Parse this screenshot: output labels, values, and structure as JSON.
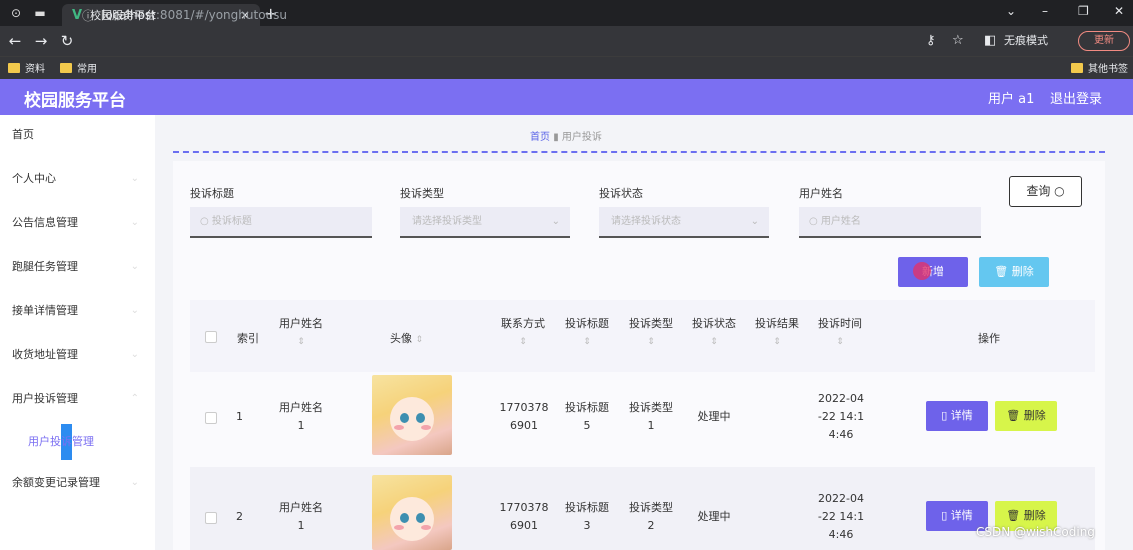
{
  "browser": {
    "tab_title": "校园服务平台",
    "tab_close": "×",
    "new_tab": "+",
    "url_host": "localhost",
    "url_path": ":8081/#/yonghutousu",
    "incognito_label": "无痕模式",
    "update_label": "更新",
    "bookmarks": [
      "资料",
      "常用"
    ],
    "other_bookmarks": "其他书签"
  },
  "header": {
    "brand": "校园服务平台",
    "user": "用户 a1",
    "logout": "退出登录"
  },
  "sidebar": {
    "items": [
      "首页",
      "个人中心",
      "公告信息管理",
      "跑腿任务管理",
      "接单详情管理",
      "收货地址管理",
      "用户投诉管理",
      "余额变更记录管理"
    ],
    "sub_item": "用户投诉管理"
  },
  "breadcrumb": {
    "home": "首页",
    "current": "用户投诉"
  },
  "filters": {
    "title_label": "投诉标题",
    "title_placeholder": "投诉标题",
    "type_label": "投诉类型",
    "type_placeholder": "请选择投诉类型",
    "status_label": "投诉状态",
    "status_placeholder": "请选择投诉状态",
    "name_label": "用户姓名",
    "name_placeholder": "用户姓名",
    "search_button": "查询"
  },
  "actions": {
    "add": "新增",
    "delete": "删除"
  },
  "table": {
    "columns": [
      "索引",
      "用户姓名",
      "头像",
      "联系方式",
      "投诉标题",
      "投诉类型",
      "投诉状态",
      "投诉结果",
      "投诉时间",
      "操作"
    ],
    "rows": [
      {
        "index": "1",
        "name": "用户姓名\n1",
        "phone": "1770378\n6901",
        "title": "投诉标题\n5",
        "type": "投诉类型\n1",
        "status": "处理中",
        "result": "",
        "time": "2022-04\n-22 14:1\n4:46"
      },
      {
        "index": "2",
        "name": "用户姓名\n1",
        "phone": "1770378\n6901",
        "title": "投诉标题\n3",
        "type": "投诉类型\n2",
        "status": "处理中",
        "result": "",
        "time": "2022-04\n-22 14:1\n4:46"
      }
    ],
    "detail_button": "详情",
    "delete_button": "删除"
  },
  "watermark": "CSDN @wishCoding"
}
